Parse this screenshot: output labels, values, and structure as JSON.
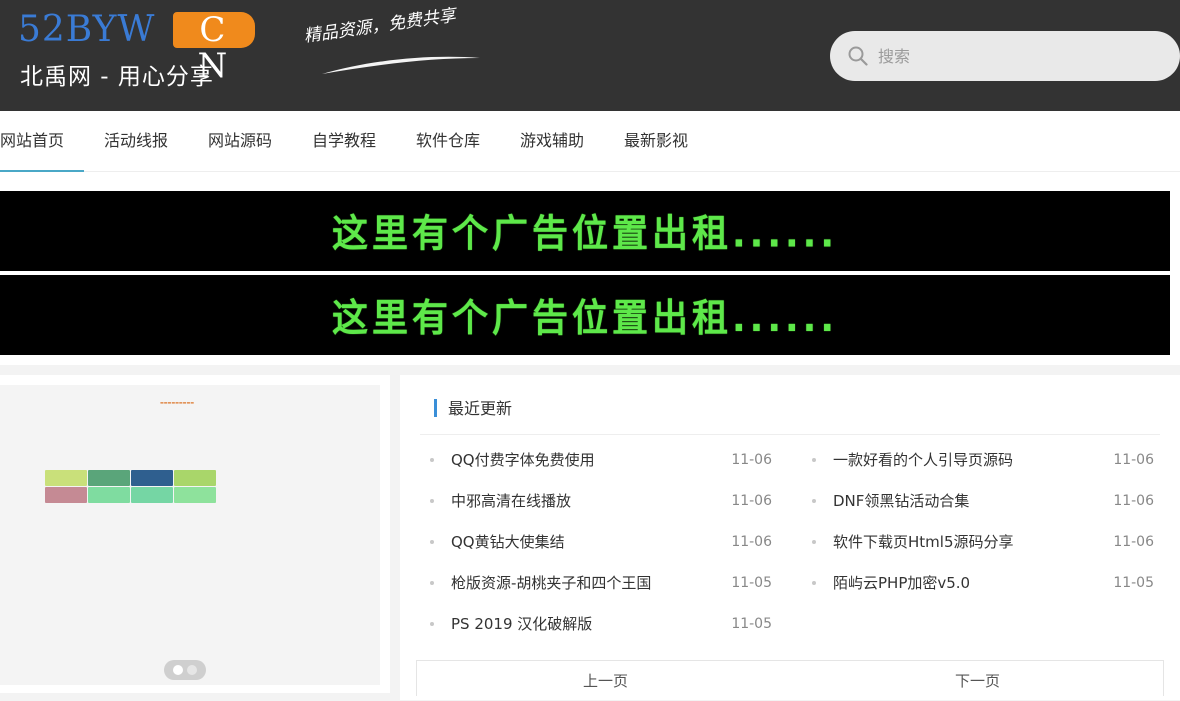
{
  "header": {
    "logo_main": "52BYW",
    "logo_badge": "C N",
    "logo_sub": "北禹网 - 用心分享",
    "slogan": "精品资源，免费共享",
    "search_placeholder": "搜索"
  },
  "nav": {
    "items": [
      "网站首页",
      "活动线报",
      "网站源码",
      "自学教程",
      "软件仓库",
      "游戏辅助",
      "最新影视"
    ],
    "active_index": 0
  },
  "ads": [
    {
      "text": "这里有个广告位置出租......"
    },
    {
      "text": "这里有个广告位置出租......"
    }
  ],
  "slider": {
    "dot_count": 2,
    "active_dot": 0
  },
  "recent": {
    "title": "最近更新",
    "left": [
      {
        "title": "QQ付费字体免费使用",
        "date": "11-06"
      },
      {
        "title": "中邪高清在线播放",
        "date": "11-06"
      },
      {
        "title": "QQ黄钻大使集结",
        "date": "11-06"
      },
      {
        "title": "枪版资源-胡桃夹子和四个王国",
        "date": "11-05"
      },
      {
        "title": "PS 2019 汉化破解版",
        "date": "11-05"
      }
    ],
    "right": [
      {
        "title": "一款好看的个人引导页源码",
        "date": "11-06"
      },
      {
        "title": "DNF领黑钻活动合集",
        "date": "11-06"
      },
      {
        "title": "软件下载页Html5源码分享",
        "date": "11-06"
      },
      {
        "title": "陌屿云PHP加密v5.0",
        "date": "11-05"
      }
    ],
    "pager": {
      "prev": "上一页",
      "next": "下一页"
    }
  },
  "colors": {
    "header_bg": "#333333",
    "logo_blue": "#3a7bd5",
    "logo_orange": "#f08a1c",
    "nav_active": "#4aa8c7",
    "ad_text": "#5ee84a",
    "accent_bar": "#3a8fd8"
  },
  "icons": {
    "search": "search-icon"
  }
}
